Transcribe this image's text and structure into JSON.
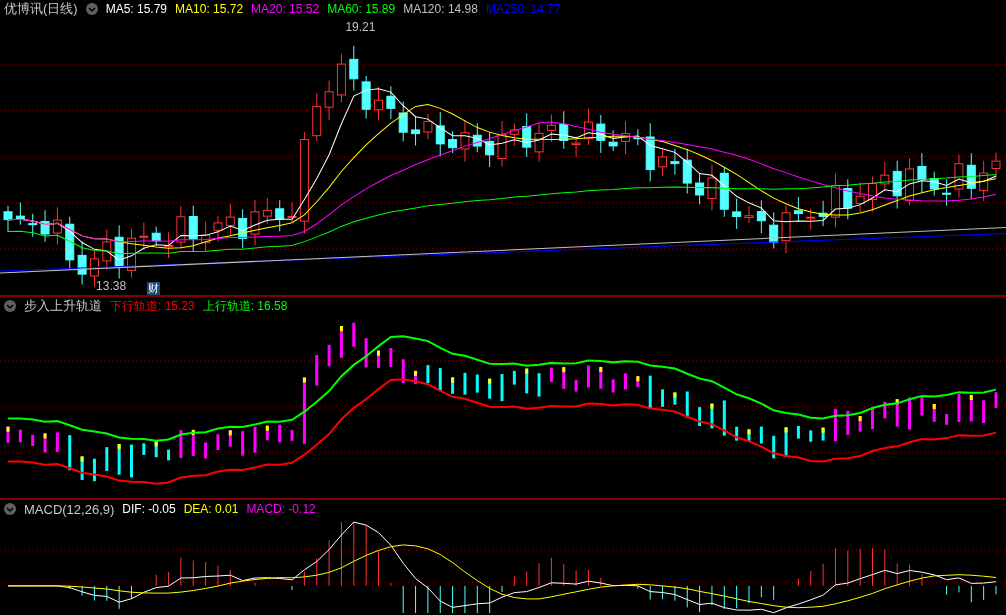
{
  "main_panel": {
    "title": "优博讯(日线)",
    "indicators": [
      {
        "label": "MA5: 15.79",
        "color": "#ffffff"
      },
      {
        "label": "MA10: 15.72",
        "color": "#ffff00"
      },
      {
        "label": "MA20: 15.52",
        "color": "#ff00ff"
      },
      {
        "label": "MA60: 15.89",
        "color": "#00ff00"
      },
      {
        "label": "MA120: 14.98",
        "color": "#c0c0c0"
      },
      {
        "label": "MA250: 14.77",
        "color": "#0000ff"
      }
    ],
    "high_label": "19.21",
    "low_label": "13.38",
    "badge": "财"
  },
  "track_panel": {
    "title": "步入上升轨道",
    "indicators": [
      {
        "label": "下行轨道: 15.23",
        "color": "#ff0000"
      },
      {
        "label": "上行轨道: 16.58",
        "color": "#00ff00"
      }
    ]
  },
  "macd_panel": {
    "title": "MACD(12,26,9)",
    "indicators": [
      {
        "label": "DIF: -0.05",
        "color": "#ffffff"
      },
      {
        "label": "DEA: 0.01",
        "color": "#ffff00"
      },
      {
        "label": "MACD: -0.12",
        "color": "#ff00ff"
      }
    ]
  }
}
